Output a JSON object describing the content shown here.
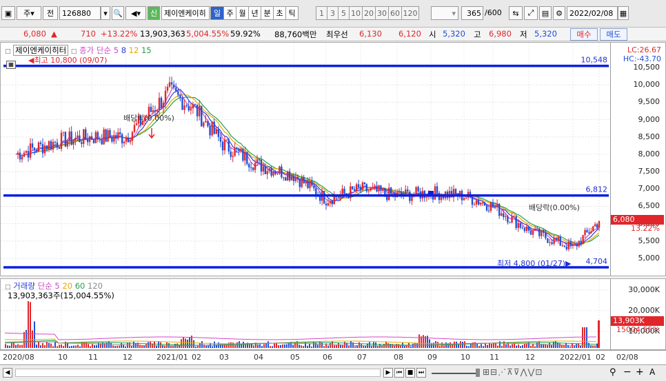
{
  "toolbar": {
    "market_label": "주",
    "prev_label": "전",
    "code": "126880",
    "new_badge": "신",
    "stock_name": "제이엔케이히",
    "periods": [
      "일",
      "주",
      "월",
      "년",
      "분",
      "초",
      "틱"
    ],
    "active_period": "일",
    "intervals": [
      "1",
      "3",
      "5",
      "10",
      "20",
      "30",
      "60",
      "120"
    ],
    "count_value": "365",
    "count_total": "/600",
    "date_value": "2022/02/08"
  },
  "quote": {
    "price": "6,080",
    "change_arrow": "▲",
    "change": "710",
    "change_pct": "+13.22%",
    "volume": "13,903,363",
    "volume_ratio": "5,004.55%",
    "rate": "59.92%",
    "amount": "88,760백만",
    "best_ask_label": "최우선",
    "best_ask": "6,130",
    "best_bid": "6,120",
    "open_label": "시",
    "open": "5,320",
    "high_label": "고",
    "high": "6,980",
    "low_label": "저",
    "low": "5,320",
    "buy_label": "매수",
    "sell_label": "매도"
  },
  "price_chart": {
    "legend_name": "제이엔케이히터",
    "legend_prefix": "종가 단순",
    "ma_periods": [
      "5",
      "8",
      "12",
      "15"
    ],
    "ma_colors": [
      "#d048c9",
      "#2a3fd8",
      "#e8a800",
      "#22a04a"
    ],
    "lc_label": "LC:26.67",
    "hc_label": "HC:-43.70",
    "high_annotation": "최고 10,800 (09/07)",
    "low_annotation": "최저 4,800 (01/27)",
    "dividend_1": "배당락(0.00%)",
    "dividend_2": "배당락(0.00%)",
    "level_top": "10,548",
    "level_mid": "6,812",
    "level_bottom": "4,704",
    "last_price": "6,080",
    "last_pct": "13.22%"
  },
  "volume_chart": {
    "legend_name": "거래량",
    "legend_prefix": "단순",
    "ma_periods": [
      "5",
      "20",
      "60",
      "120"
    ],
    "ma_colors": [
      "#d048c9",
      "#e8a800",
      "#22a04a",
      "#8a8a8a"
    ],
    "info": "13,903,363주(15,004.55%)",
    "last_volume": "13,903K",
    "last_pct": "15004.55%"
  },
  "chart_data": [
    {
      "type": "line",
      "title": "제이엔케이히터",
      "xlabel": "",
      "ylabel": "",
      "ylim": [
        4704,
        10800
      ],
      "x": [
        "2020/08",
        "10",
        "11",
        "12",
        "2021/01",
        "02",
        "03",
        "04",
        "05",
        "06",
        "07",
        "08",
        "09",
        "10",
        "11",
        "12",
        "2022/01",
        "02"
      ],
      "y_ticks": [
        "10,500",
        "10,000",
        "9,500",
        "9,000",
        "8,500",
        "8,000",
        "7,500",
        "7,000",
        "6,500",
        "6,000",
        "5,500",
        "5,000"
      ],
      "series": [
        {
          "name": "",
          "values": [
            8000,
            8400,
            8500,
            8500,
            9800,
            9300,
            8300,
            7700,
            7400,
            6700,
            7000,
            6800,
            6900,
            6800,
            6500,
            5800,
            5300,
            6080
          ]
        }
      ],
      "reference_levels": [
        10548,
        6812,
        4704
      ]
    },
    {
      "type": "bar",
      "title": "거래량",
      "y_ticks": [
        "30,000K",
        "20,000K",
        "10,000K"
      ],
      "volume_spike_k": 13903
    }
  ],
  "x_axis_end_label": "02/08"
}
